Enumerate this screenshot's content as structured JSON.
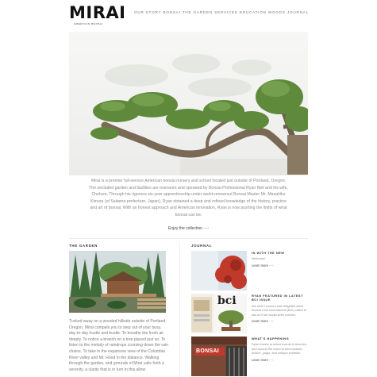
{
  "header": {
    "logo": "MIRAI",
    "logo_sub": "AMERICAN BONSAI",
    "nav": [
      "OUR STORY",
      "BONSAI",
      "THE GARDEN",
      "SERVICES",
      "EDUCATION",
      "WOODS",
      "JOURNAL"
    ]
  },
  "intro": {
    "text": "Mirai is a premier full-service American bonsai nursery and school located just outside of Portland, Oregon. The secluded garden and facilities are overseen and operated by Bonsai Professional Ryan Neil and his wife, Chelsea. Through his rigorous six-year apprenticeship under world-renowned Bonsai Master Mr. Masahiko Kimura (of Saitama prefecture, Japan), Ryan obtained a deep and refined knowledge of the history, practice and art of bonsai. With an honest approach and American innovation, Ryan is now pushing the limits of what bonsai can be.",
    "enjoy_label": "Enjoy the collection",
    "enjoy_arrow": "—›"
  },
  "garden": {
    "title": "THE GARDEN",
    "text": "Tucked away on a wooded hillside outside of Portland, Oregon, Mirai compels you to step out of your busy, day-to-day hustle and bustle. To breathe the fresh air deeply. To notice a branch on a tree placed just so. To listen to the melody of raindrops coursing down the rain chains. To take in the expansive view of the Columbia River valley and Mt. Hood in the distance. Walking through the garden, and grounds of Mirai calls forth a serenity, a clarity that is in turn in this allow"
  },
  "journal": {
    "title": "JOURNAL",
    "items": [
      {
        "head": "IN WITH THE NEW",
        "text": "Welcome!",
        "more": "Learn more",
        "arrow": "—›"
      },
      {
        "head": "RYAN FEATURED IN LATEST BCI ISSUE",
        "text": "We were honored and delighted when Bonsai Club International (BCI) called to ask us if we would write a featur",
        "more": "Learn more",
        "arrow": "—›"
      },
      {
        "head": "WHAT'S HAPPENING",
        "text": "Ryan travels to select events in America and around the world to demonstrate, lecture, judge, and critique exhibitio",
        "more": "Learn more",
        "arrow": "—›"
      }
    ],
    "thumb2_label": "bci",
    "thumb3_label": "BONSAI"
  },
  "colors": {
    "accent_red": "#c0392b",
    "foliage": "#5f8a3c",
    "bark": "#7a6a55"
  }
}
